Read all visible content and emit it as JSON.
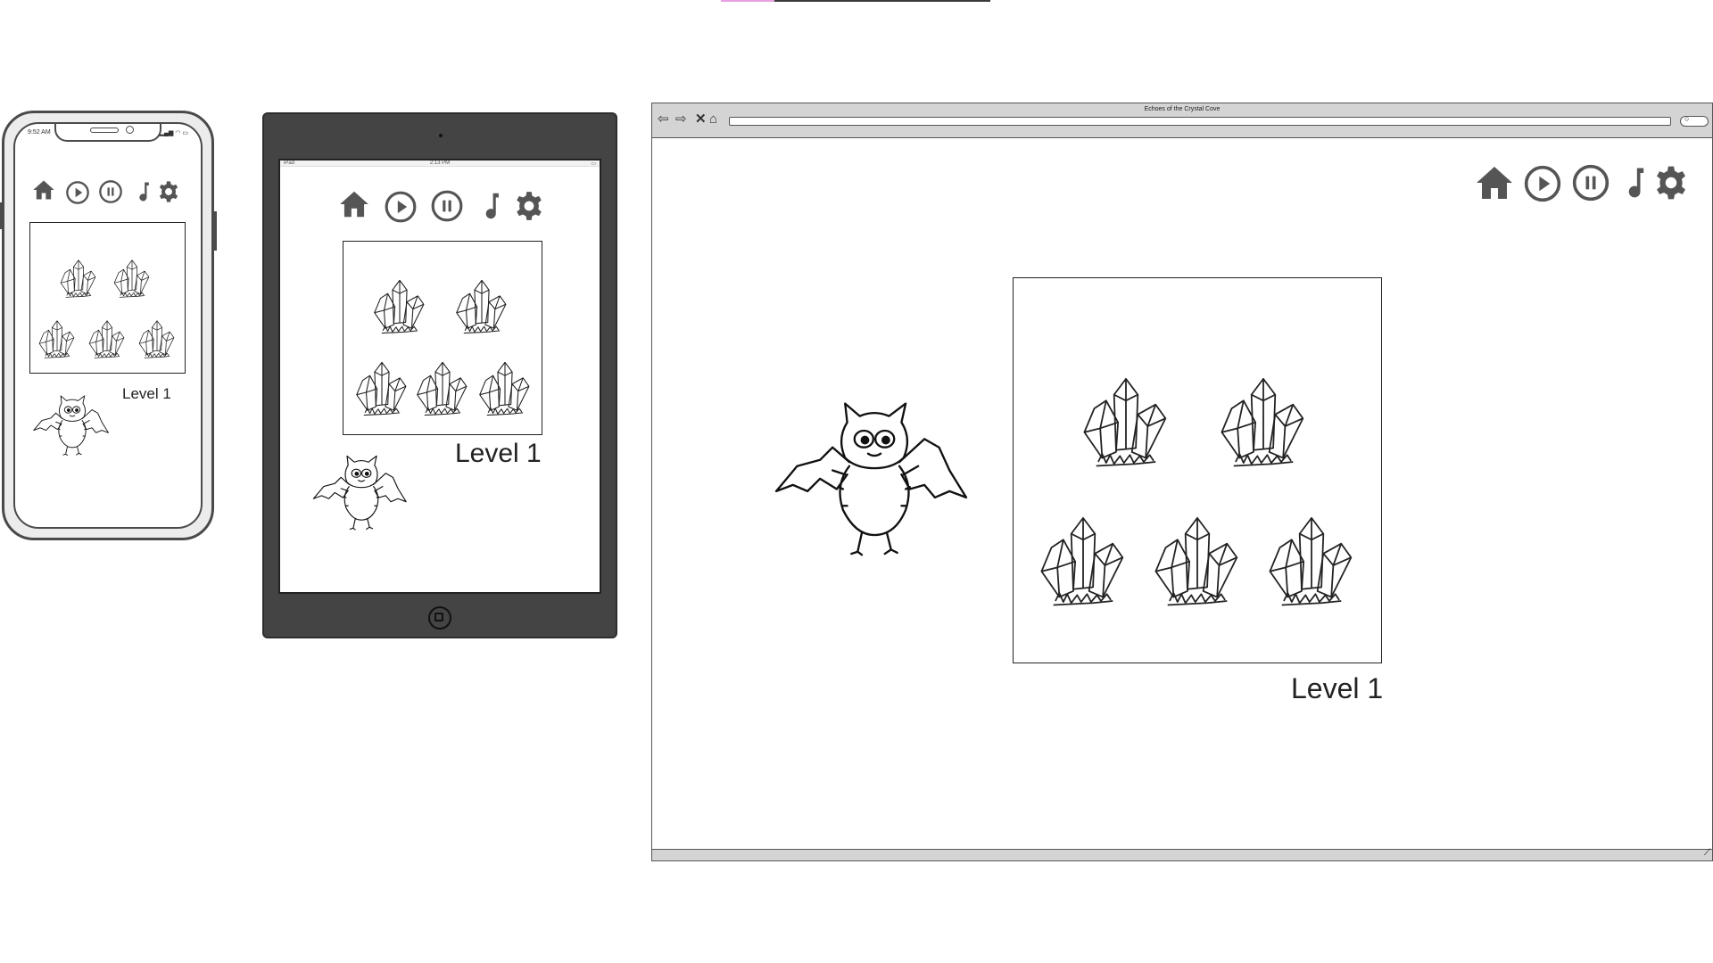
{
  "browser": {
    "title": "Echoes of the Crystal Cove",
    "nav_icons": [
      "back-arrow-icon",
      "forward-arrow-icon",
      "close-icon",
      "home-outline-icon"
    ]
  },
  "toolbar_icons": [
    "home-icon",
    "play-icon",
    "pause-icon",
    "music-note-icon",
    "gear-icon"
  ],
  "game": {
    "level_label": "Level 1",
    "crystal_count": 5
  },
  "phone": {
    "status_time": "9:52 AM"
  },
  "tablet": {
    "status_left": "iPad",
    "status_time": "2:13 PM"
  },
  "colors": {
    "icon": "#555555",
    "device_frame": "#444444",
    "browser_chrome": "#d4d4d4"
  }
}
